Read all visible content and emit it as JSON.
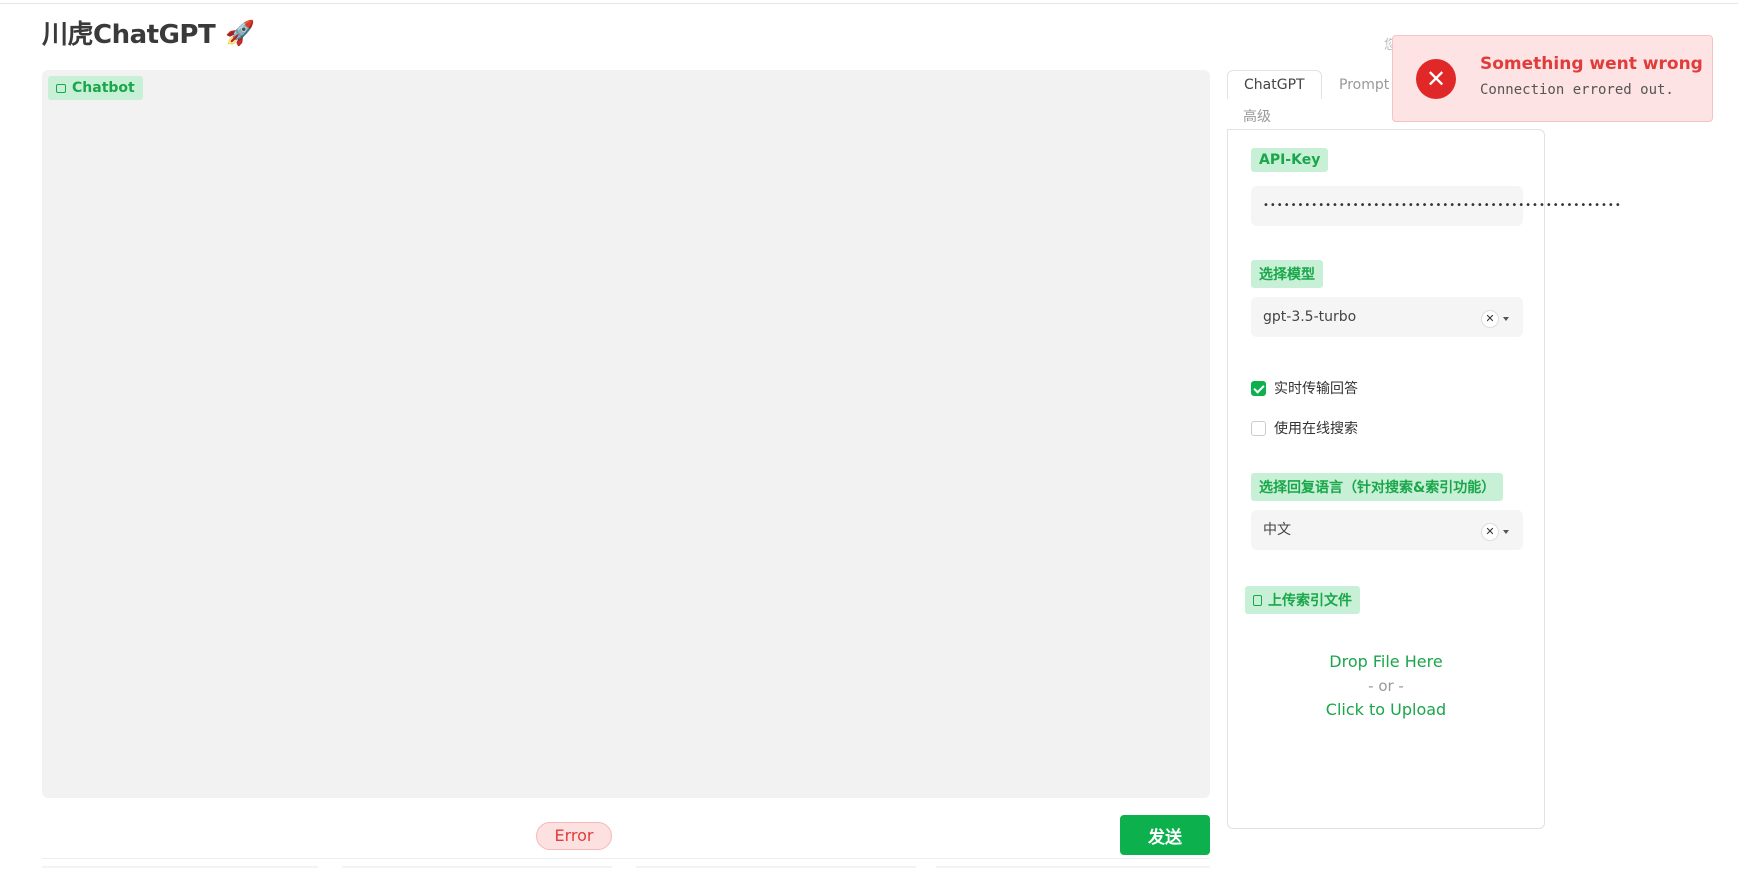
{
  "app": {
    "title": "川虎ChatGPT",
    "title_emoji": "🚀"
  },
  "chatbot": {
    "label": "Chatbot"
  },
  "input": {
    "status_pill": "Error",
    "send_label": "发送"
  },
  "tabs": [
    {
      "label": "ChatGPT",
      "active": true
    },
    {
      "label": "Prompt",
      "active": false
    },
    {
      "label": "高级",
      "active": false
    }
  ],
  "panel": {
    "api_key": {
      "label": "API-Key",
      "value": "••••••••••••••••••••••••••••••••••••••••••••••••••••"
    },
    "model": {
      "label": "选择模型",
      "value": "gpt-3.5-turbo"
    },
    "stream": {
      "label": "实时传输回答",
      "checked": true
    },
    "online_search": {
      "label": "使用在线搜索",
      "checked": false
    },
    "reply_language": {
      "label": "选择回复语言（针对搜索&索引功能）",
      "value": "中文"
    },
    "upload": {
      "label": "上传索引文件",
      "drop_text": "Drop File Here",
      "or_text": "- or -",
      "click_text": "Click to Upload"
    }
  },
  "toast": {
    "title": "Something went wrong",
    "message": "Connection errored out."
  },
  "peek_text": "您"
}
